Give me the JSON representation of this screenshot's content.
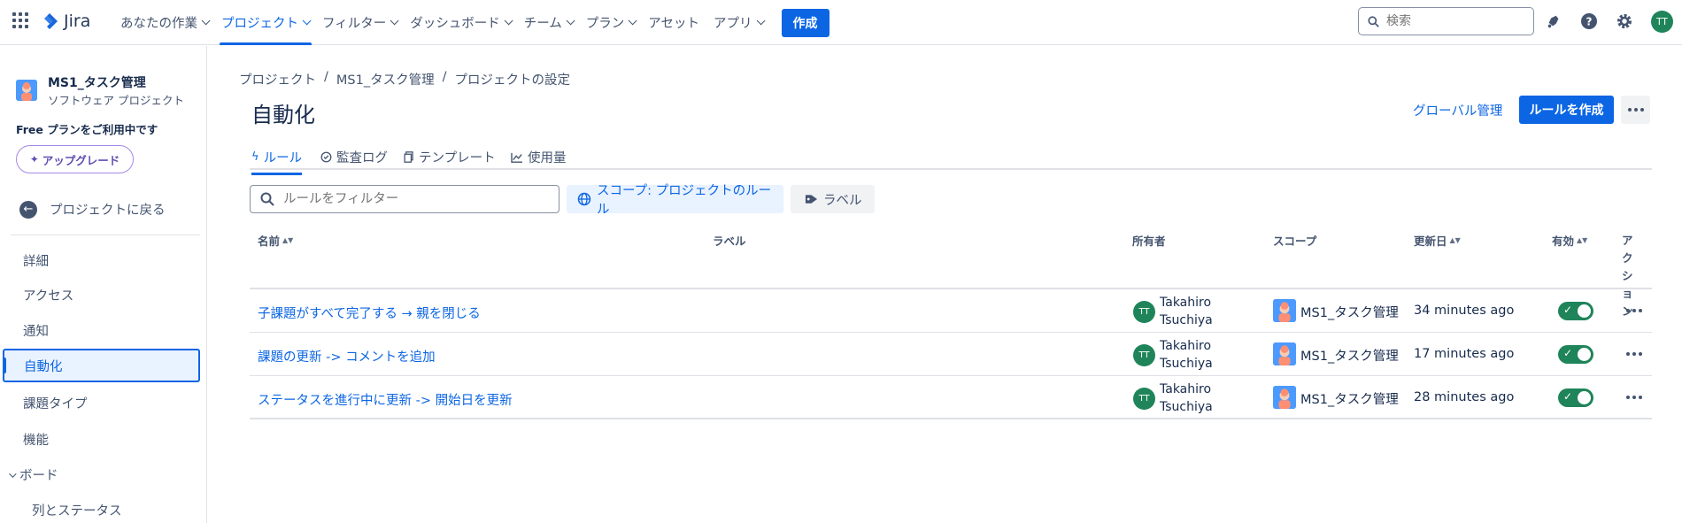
{
  "topnav": {
    "logo_text": "Jira",
    "items": [
      {
        "label": "あなたの作業"
      },
      {
        "label": "プロジェクト"
      },
      {
        "label": "フィルター"
      },
      {
        "label": "ダッシュボード"
      },
      {
        "label": "チーム"
      },
      {
        "label": "プラン"
      },
      {
        "label": "アセット"
      },
      {
        "label": "アプリ"
      }
    ],
    "create_label": "作成",
    "search_placeholder": "検索",
    "user_initials": "TT"
  },
  "sidebar": {
    "project_name": "MS1_タスク管理",
    "project_type": "ソフトウェア プロジェクト",
    "plan_text": "Free プランをご利用中です",
    "upgrade_label": "アップグレード",
    "back_label": "プロジェクトに戻る",
    "items": [
      {
        "label": "詳細"
      },
      {
        "label": "アクセス"
      },
      {
        "label": "通知"
      },
      {
        "label": "自動化"
      },
      {
        "label": "課題タイプ"
      },
      {
        "label": "機能"
      }
    ],
    "section_label": "ボード",
    "sub_item": "列とステータス"
  },
  "breadcrumb": [
    "プロジェクト",
    "/",
    "MS1_タスク管理",
    "/",
    "プロジェクトの設定"
  ],
  "page": {
    "title": "自動化",
    "global_link": "グローバル管理",
    "create_rule_label": "ルールを作成"
  },
  "tabs": [
    {
      "label": "ルール"
    },
    {
      "label": "監査ログ"
    },
    {
      "label": "テンプレート"
    },
    {
      "label": "使用量"
    }
  ],
  "filters": {
    "filter_placeholder": "ルールをフィルター",
    "scope_label": "スコープ: プロジェクトのルール",
    "label_label": "ラベル"
  },
  "table": {
    "headers": {
      "name": "名前",
      "label": "ラベル",
      "owner": "所有者",
      "scope": "スコープ",
      "updated": "更新日",
      "enabled": "有効",
      "action": "アクション"
    },
    "rows": [
      {
        "name": "子課題がすべて完了する → 親を閉じる",
        "owner_initials": "TT",
        "owner_first": "Takahiro",
        "owner_last": "Tsuchiya",
        "scope": "MS1_タスク管理",
        "updated": "34 minutes ago",
        "enabled": true
      },
      {
        "name": "課題の更新 -> コメントを追加",
        "owner_initials": "TT",
        "owner_first": "Takahiro",
        "owner_last": "Tsuchiya",
        "scope": "MS1_タスク管理",
        "updated": "17 minutes ago",
        "enabled": true
      },
      {
        "name": "ステータスを進行中に更新 -> 開始日を更新",
        "owner_initials": "TT",
        "owner_first": "Takahiro",
        "owner_last": "Tsuchiya",
        "scope": "MS1_タスク管理",
        "updated": "28 minutes ago",
        "enabled": true
      }
    ]
  },
  "colors": {
    "accent": "#0c66e4",
    "toggle_on": "#1f845a",
    "avatar_green": "#1f845a"
  }
}
